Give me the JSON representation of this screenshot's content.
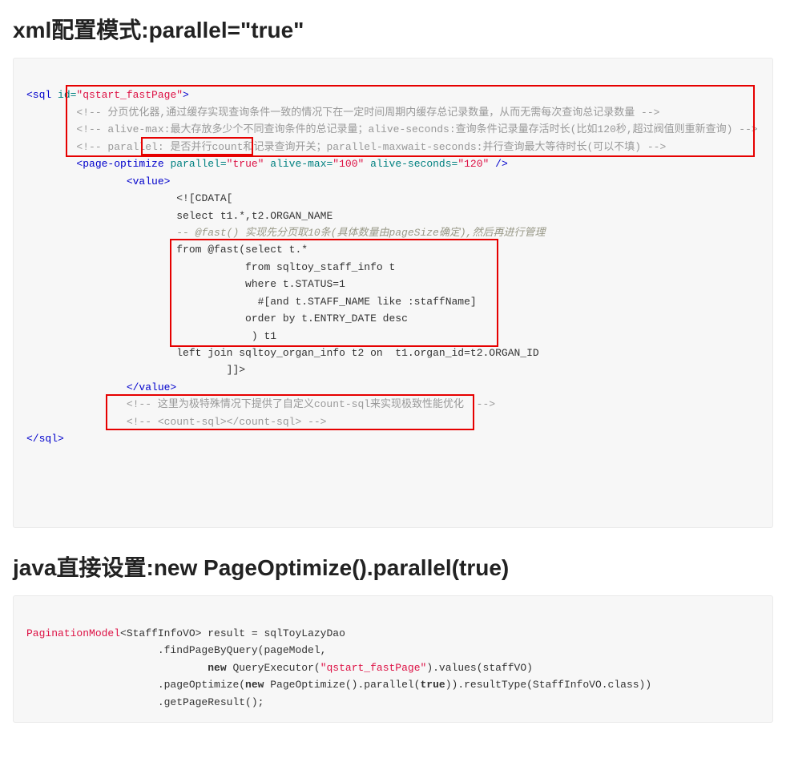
{
  "heading1": "xml配置模式:parallel=\"true\"",
  "xml": {
    "open_sql": "<sql ",
    "open_sql_attr": "id=",
    "open_sql_val": "\"qstart_fastPage\"",
    "open_sql_close": ">",
    "cmt1": "<!-- 分页优化器,通过缓存实现查询条件一致的情况下在一定时间周期内缓存总记录数量，从而无需每次查询总记录数量 -->",
    "cmt2": "<!-- alive-max:最大存放多少个不同查询条件的总记录量；alive-seconds:查询条件记录量存活时长(比如120秒,超过阀值则重新查询) -->",
    "cmt3": "<!-- parallel: 是否并行count和记录查询开关；parallel-maxwait-seconds:并行查询最大等待时长(可以不填) -->",
    "po_open": "<page-optimize ",
    "po_a1": "parallel=",
    "po_v1": "\"true\" ",
    "po_a2": "alive-max=",
    "po_v2": "\"100\" ",
    "po_a3": "alive-seconds=",
    "po_v3": "\"120\" ",
    "po_close": "/>",
    "value_open": "<value>",
    "cdata_open": "<![CDATA[",
    "sql_l1": "select t1.*,t2.ORGAN_NAME",
    "sql_c": "-- @fast() 实现先分页取10条(具体数量由pageSize确定),然后再进行管理",
    "sql_l2": "from @fast(select t.*",
    "sql_l3": "           from sqltoy_staff_info t",
    "sql_l4": "           where t.STATUS=1",
    "sql_l5": "             #[and t.STAFF_NAME like :staffName]",
    "sql_l6": "           order by t.ENTRY_DATE desc",
    "sql_l7": "            ) t1",
    "sql_l8": "left join sqltoy_organ_info t2 on  t1.organ_id=t2.ORGAN_ID",
    "cdata_close": "]]>",
    "value_close": "</value>",
    "cmt4": "<!-- 这里为极特殊情况下提供了自定义count-sql来实现极致性能优化  -->",
    "cmt5": "<!-- <count-sql></count-sql> -->",
    "close_sql": "</sql>"
  },
  "heading2": "java直接设置:new PageOptimize().parallel(true)",
  "java": {
    "l1_a": "PaginationModel",
    "l1_b": "<StaffInfoVO> result = sqlToyLazyDao",
    "l2": "                     .findPageByQuery(pageModel,",
    "l3_a": "                             ",
    "l3_new": "new",
    "l3_b": " QueryExecutor(",
    "l3_s": "\"qstart_fastPage\"",
    "l3_c": ").values(staffVO)",
    "l4_a": "                     .pageOptimize(",
    "l4_new": "new",
    "l4_b": " PageOptimize().parallel(",
    "l4_t": "true",
    "l4_c": ")).resultType(StaffInfoVO.class))",
    "l5": "                     .getPageResult();"
  }
}
